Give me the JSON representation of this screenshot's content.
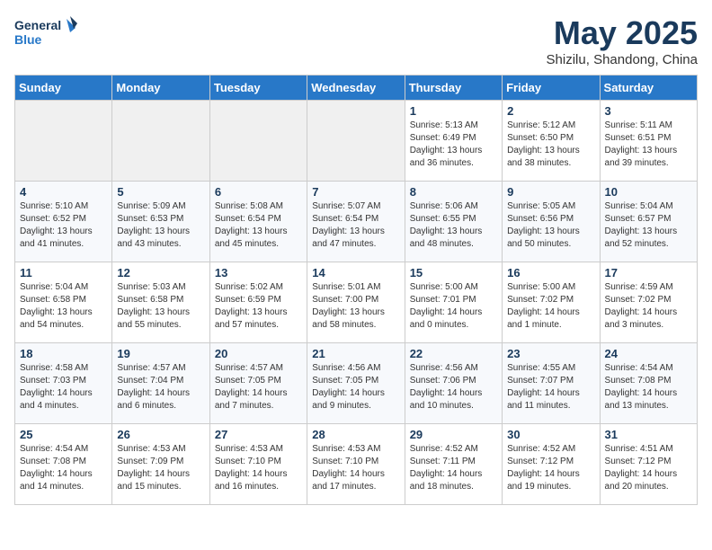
{
  "logo": {
    "line1": "General",
    "line2": "Blue"
  },
  "title": "May 2025",
  "location": "Shizilu, Shandong, China",
  "weekdays": [
    "Sunday",
    "Monday",
    "Tuesday",
    "Wednesday",
    "Thursday",
    "Friday",
    "Saturday"
  ],
  "weeks": [
    [
      {
        "day": "",
        "info": ""
      },
      {
        "day": "",
        "info": ""
      },
      {
        "day": "",
        "info": ""
      },
      {
        "day": "",
        "info": ""
      },
      {
        "day": "1",
        "info": "Sunrise: 5:13 AM\nSunset: 6:49 PM\nDaylight: 13 hours\nand 36 minutes."
      },
      {
        "day": "2",
        "info": "Sunrise: 5:12 AM\nSunset: 6:50 PM\nDaylight: 13 hours\nand 38 minutes."
      },
      {
        "day": "3",
        "info": "Sunrise: 5:11 AM\nSunset: 6:51 PM\nDaylight: 13 hours\nand 39 minutes."
      }
    ],
    [
      {
        "day": "4",
        "info": "Sunrise: 5:10 AM\nSunset: 6:52 PM\nDaylight: 13 hours\nand 41 minutes."
      },
      {
        "day": "5",
        "info": "Sunrise: 5:09 AM\nSunset: 6:53 PM\nDaylight: 13 hours\nand 43 minutes."
      },
      {
        "day": "6",
        "info": "Sunrise: 5:08 AM\nSunset: 6:54 PM\nDaylight: 13 hours\nand 45 minutes."
      },
      {
        "day": "7",
        "info": "Sunrise: 5:07 AM\nSunset: 6:54 PM\nDaylight: 13 hours\nand 47 minutes."
      },
      {
        "day": "8",
        "info": "Sunrise: 5:06 AM\nSunset: 6:55 PM\nDaylight: 13 hours\nand 48 minutes."
      },
      {
        "day": "9",
        "info": "Sunrise: 5:05 AM\nSunset: 6:56 PM\nDaylight: 13 hours\nand 50 minutes."
      },
      {
        "day": "10",
        "info": "Sunrise: 5:04 AM\nSunset: 6:57 PM\nDaylight: 13 hours\nand 52 minutes."
      }
    ],
    [
      {
        "day": "11",
        "info": "Sunrise: 5:04 AM\nSunset: 6:58 PM\nDaylight: 13 hours\nand 54 minutes."
      },
      {
        "day": "12",
        "info": "Sunrise: 5:03 AM\nSunset: 6:58 PM\nDaylight: 13 hours\nand 55 minutes."
      },
      {
        "day": "13",
        "info": "Sunrise: 5:02 AM\nSunset: 6:59 PM\nDaylight: 13 hours\nand 57 minutes."
      },
      {
        "day": "14",
        "info": "Sunrise: 5:01 AM\nSunset: 7:00 PM\nDaylight: 13 hours\nand 58 minutes."
      },
      {
        "day": "15",
        "info": "Sunrise: 5:00 AM\nSunset: 7:01 PM\nDaylight: 14 hours\nand 0 minutes."
      },
      {
        "day": "16",
        "info": "Sunrise: 5:00 AM\nSunset: 7:02 PM\nDaylight: 14 hours\nand 1 minute."
      },
      {
        "day": "17",
        "info": "Sunrise: 4:59 AM\nSunset: 7:02 PM\nDaylight: 14 hours\nand 3 minutes."
      }
    ],
    [
      {
        "day": "18",
        "info": "Sunrise: 4:58 AM\nSunset: 7:03 PM\nDaylight: 14 hours\nand 4 minutes."
      },
      {
        "day": "19",
        "info": "Sunrise: 4:57 AM\nSunset: 7:04 PM\nDaylight: 14 hours\nand 6 minutes."
      },
      {
        "day": "20",
        "info": "Sunrise: 4:57 AM\nSunset: 7:05 PM\nDaylight: 14 hours\nand 7 minutes."
      },
      {
        "day": "21",
        "info": "Sunrise: 4:56 AM\nSunset: 7:05 PM\nDaylight: 14 hours\nand 9 minutes."
      },
      {
        "day": "22",
        "info": "Sunrise: 4:56 AM\nSunset: 7:06 PM\nDaylight: 14 hours\nand 10 minutes."
      },
      {
        "day": "23",
        "info": "Sunrise: 4:55 AM\nSunset: 7:07 PM\nDaylight: 14 hours\nand 11 minutes."
      },
      {
        "day": "24",
        "info": "Sunrise: 4:54 AM\nSunset: 7:08 PM\nDaylight: 14 hours\nand 13 minutes."
      }
    ],
    [
      {
        "day": "25",
        "info": "Sunrise: 4:54 AM\nSunset: 7:08 PM\nDaylight: 14 hours\nand 14 minutes."
      },
      {
        "day": "26",
        "info": "Sunrise: 4:53 AM\nSunset: 7:09 PM\nDaylight: 14 hours\nand 15 minutes."
      },
      {
        "day": "27",
        "info": "Sunrise: 4:53 AM\nSunset: 7:10 PM\nDaylight: 14 hours\nand 16 minutes."
      },
      {
        "day": "28",
        "info": "Sunrise: 4:53 AM\nSunset: 7:10 PM\nDaylight: 14 hours\nand 17 minutes."
      },
      {
        "day": "29",
        "info": "Sunrise: 4:52 AM\nSunset: 7:11 PM\nDaylight: 14 hours\nand 18 minutes."
      },
      {
        "day": "30",
        "info": "Sunrise: 4:52 AM\nSunset: 7:12 PM\nDaylight: 14 hours\nand 19 minutes."
      },
      {
        "day": "31",
        "info": "Sunrise: 4:51 AM\nSunset: 7:12 PM\nDaylight: 14 hours\nand 20 minutes."
      }
    ]
  ]
}
